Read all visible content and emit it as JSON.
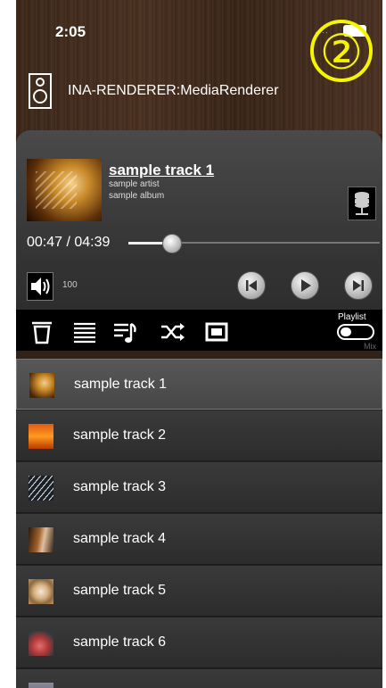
{
  "status_bar": {
    "time": "2:05"
  },
  "overlay_badge": "②",
  "renderer": {
    "name": "INA-RENDERER:MediaRenderer"
  },
  "now_playing": {
    "title": "sample track 1",
    "artist": "sample artist",
    "album": "sample album",
    "time": "00:47 / 04:39",
    "progress": 0.17,
    "volume": "100"
  },
  "controls": {
    "icons": [
      "speaker-icon",
      "skip-previous-icon",
      "play-icon",
      "skip-next-icon",
      "database-icon"
    ]
  },
  "toolbar": {
    "icons": [
      "trash-icon",
      "list-icon",
      "queue-music-icon",
      "shuffle-icon",
      "repeat-icon"
    ],
    "playlist_label": "Playlist",
    "mix_label": "Mix"
  },
  "playlist": {
    "items": [
      {
        "label": "sample track 1",
        "selected": true
      },
      {
        "label": "sample track 2"
      },
      {
        "label": "sample track 3"
      },
      {
        "label": "sample track 4"
      },
      {
        "label": "sample track 5"
      },
      {
        "label": "sample track 6"
      }
    ]
  },
  "colors": {
    "accent": "#f5f500",
    "toolbar_bg": "#000000"
  }
}
